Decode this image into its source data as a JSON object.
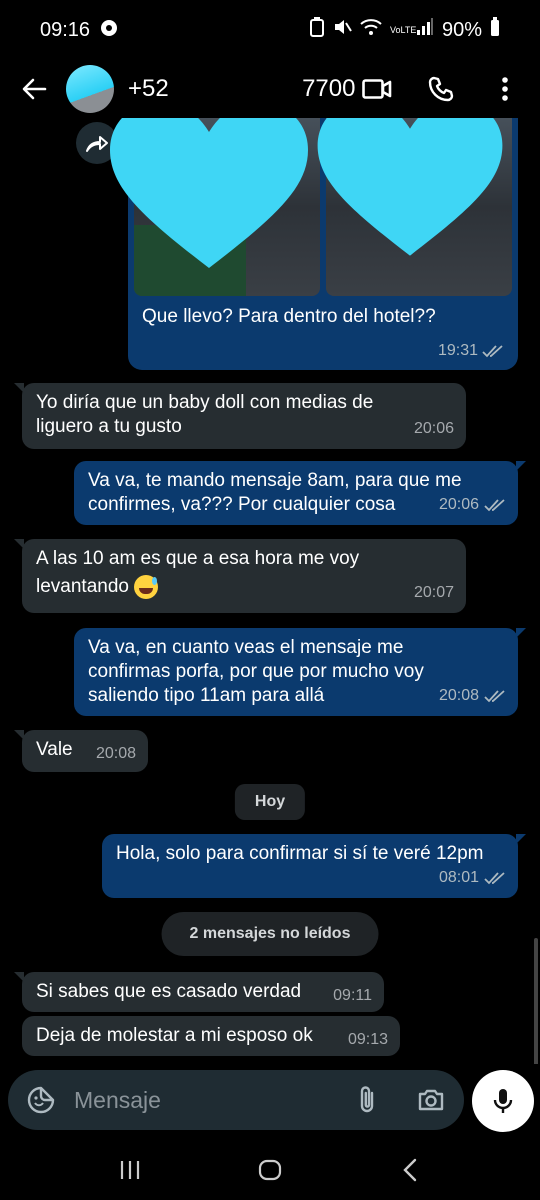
{
  "status_bar": {
    "time": "09:16",
    "battery": "90%",
    "network": "VoLTE"
  },
  "header": {
    "contact_name": "+52 ██ ███ 7700",
    "contact_visible_prefix": "+52",
    "contact_visible_suffix": "7700"
  },
  "messages": [
    {
      "id": "m1",
      "direction": "out",
      "type": "media",
      "text": "Que llevo? Para dentro del hotel??",
      "time": "19:31",
      "status": "read"
    },
    {
      "id": "m2",
      "direction": "in",
      "text_line1": "Yo diría que un baby doll con medias de",
      "text_line2": "liguero a tu gusto",
      "time": "20:06"
    },
    {
      "id": "m3",
      "direction": "out",
      "text_line1": "Va va, te mando mensaje 8am, para que me",
      "text_line2": "confirmes, va??? Por cualquier cosa",
      "time": "20:06",
      "status": "read"
    },
    {
      "id": "m4",
      "direction": "in",
      "text_line1": "A las 10 am es que a esa hora me voy",
      "text_line2": "levantando",
      "emoji": "sweat-smile",
      "time": "20:07"
    },
    {
      "id": "m5",
      "direction": "out",
      "text_line1": "Va va, en cuanto veas el mensaje me",
      "text_line2": "confirmas porfa, por que por mucho voy",
      "text_line3": "saliendo tipo 11am para allá",
      "time": "20:08",
      "status": "read"
    },
    {
      "id": "m6",
      "direction": "in",
      "text": "Vale",
      "time": "20:08"
    },
    {
      "id": "m7",
      "direction": "out",
      "text": "Hola, solo para confirmar si sí te veré 12pm",
      "time": "08:01",
      "status": "read"
    },
    {
      "id": "m8",
      "direction": "in",
      "text": "Si sabes que es casado verdad",
      "time": "09:11"
    },
    {
      "id": "m9",
      "direction": "in",
      "text": "Deja de molestar a mi esposo ok",
      "time": "09:13"
    }
  ],
  "date_divider": "Hoy",
  "unread_divider": "2 mensajes no leídos",
  "composer": {
    "placeholder": "Mensaje"
  },
  "icons": {
    "back": "arrow-left",
    "video": "video-camera",
    "call": "phone",
    "menu": "more-vertical",
    "forward": "forward-arrow",
    "sticker": "emoji-sticker",
    "attach": "paperclip",
    "camera": "camera",
    "mic": "microphone"
  },
  "colors": {
    "outgoing_bubble": "#0b3a6e",
    "incoming_bubble": "#262d31",
    "heart": "#3fd6f5",
    "background": "#000000"
  }
}
